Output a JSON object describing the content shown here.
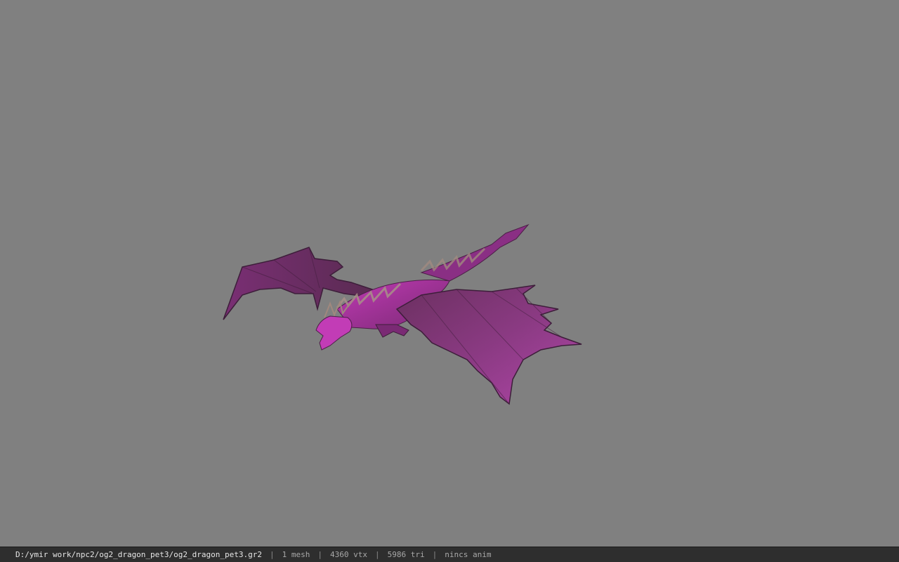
{
  "viewer": {
    "background_color": "#808080",
    "model_icon": "dragon-model",
    "model_color": "#8e2c8a"
  },
  "status": {
    "file_path": "D:/ymir work/npc2/og2_dragon_pet3/og2_dragon_pet3.gr2",
    "separator": "|",
    "mesh_count": "1 mesh",
    "vertex_count": "4360 vtx",
    "triangle_count": "5986 tri",
    "animation": "nincs anim"
  }
}
